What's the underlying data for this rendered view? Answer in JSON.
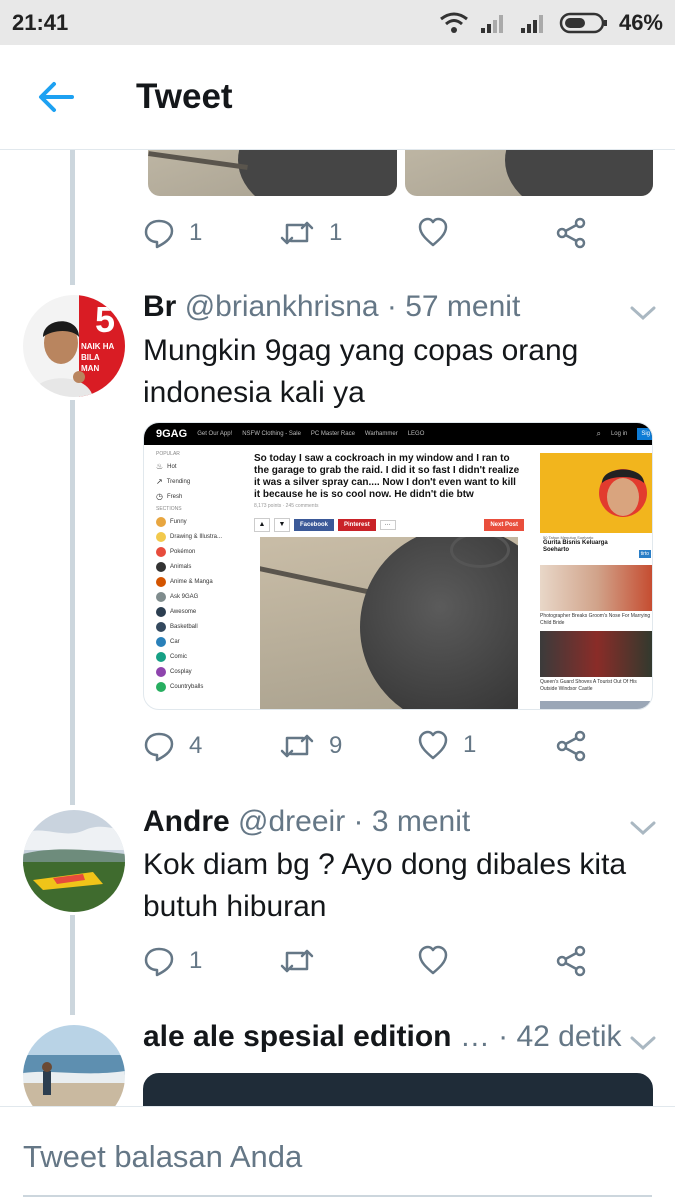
{
  "status_bar": {
    "time": "21:41",
    "battery": "46%"
  },
  "header": {
    "title": "Tweet"
  },
  "tweets": [
    {
      "actions": {
        "reply": "1",
        "retweet": "1",
        "like": ""
      }
    },
    {
      "name": "Br",
      "handle": "@briankhrisna",
      "time": "· 57 menit",
      "text": "Mungkin 9gag yang copas orang indonesia kali ya",
      "avatar_badge": "5",
      "avatar_caption": "NAIK HA BILA MAN",
      "actions": {
        "reply": "4",
        "retweet": "9",
        "like": "1"
      },
      "screenshot": {
        "logo": "9GAG",
        "nav": [
          "Get Our App!",
          "NSFW Clothing - Sale",
          "PC Master Race",
          "Warhammer",
          "LEGO"
        ],
        "login": "Log in",
        "signup": "Sig",
        "post_title": "So today I saw a cockroach in my window and I ran to the garage to grab the raid. I did it so fast I didn't realize it was a silver spray can.... Now I don't even want to kill it because he is so cool now. He didn't die btw",
        "post_meta": "8,173 points · 245 comments",
        "facebook": "Facebook",
        "pinterest": "Pinterest",
        "more": "···",
        "next_post": "Next Post",
        "sidebar_popular_label": "POPULAR",
        "sidebar_popular": [
          "Hot",
          "Trending",
          "Fresh"
        ],
        "sidebar_sections_label": "SECTIONS",
        "sidebar_sections": [
          "Funny",
          "Drawing & Illustra...",
          "Pokémon",
          "Animals",
          "Anime & Manga",
          "Ask 9GAG",
          "Awesome",
          "Basketball",
          "Car",
          "Comic",
          "Cosplay",
          "Countryballs"
        ],
        "ad_small": "50 Tahun Menutup Soeharto",
        "ad_title": "Gurita Bisnis Keluarga Soeharto",
        "ad_brand": "tirto",
        "related": [
          "Photographer Breaks Groom's Nose For Marrying Child Bride",
          "Queen's Guard Shoves A Tourist Out Of His Outside Windsor Castle"
        ]
      }
    },
    {
      "name": "Andre",
      "handle": "@dreeir",
      "time": "· 3 menit",
      "text": "Kok diam bg ? Ayo dong dibales kita butuh hiburan",
      "actions": {
        "reply": "1",
        "retweet": "",
        "like": ""
      }
    },
    {
      "name": "ale ale spesial edition",
      "ellipsis": "…",
      "time": "· 42 detik"
    }
  ],
  "reply_placeholder": "Tweet balasan Anda",
  "colors": {
    "accent": "#1da1f2",
    "muted": "#657786",
    "line": "#ccd6dd",
    "status_bg": "#e8e8e8"
  }
}
